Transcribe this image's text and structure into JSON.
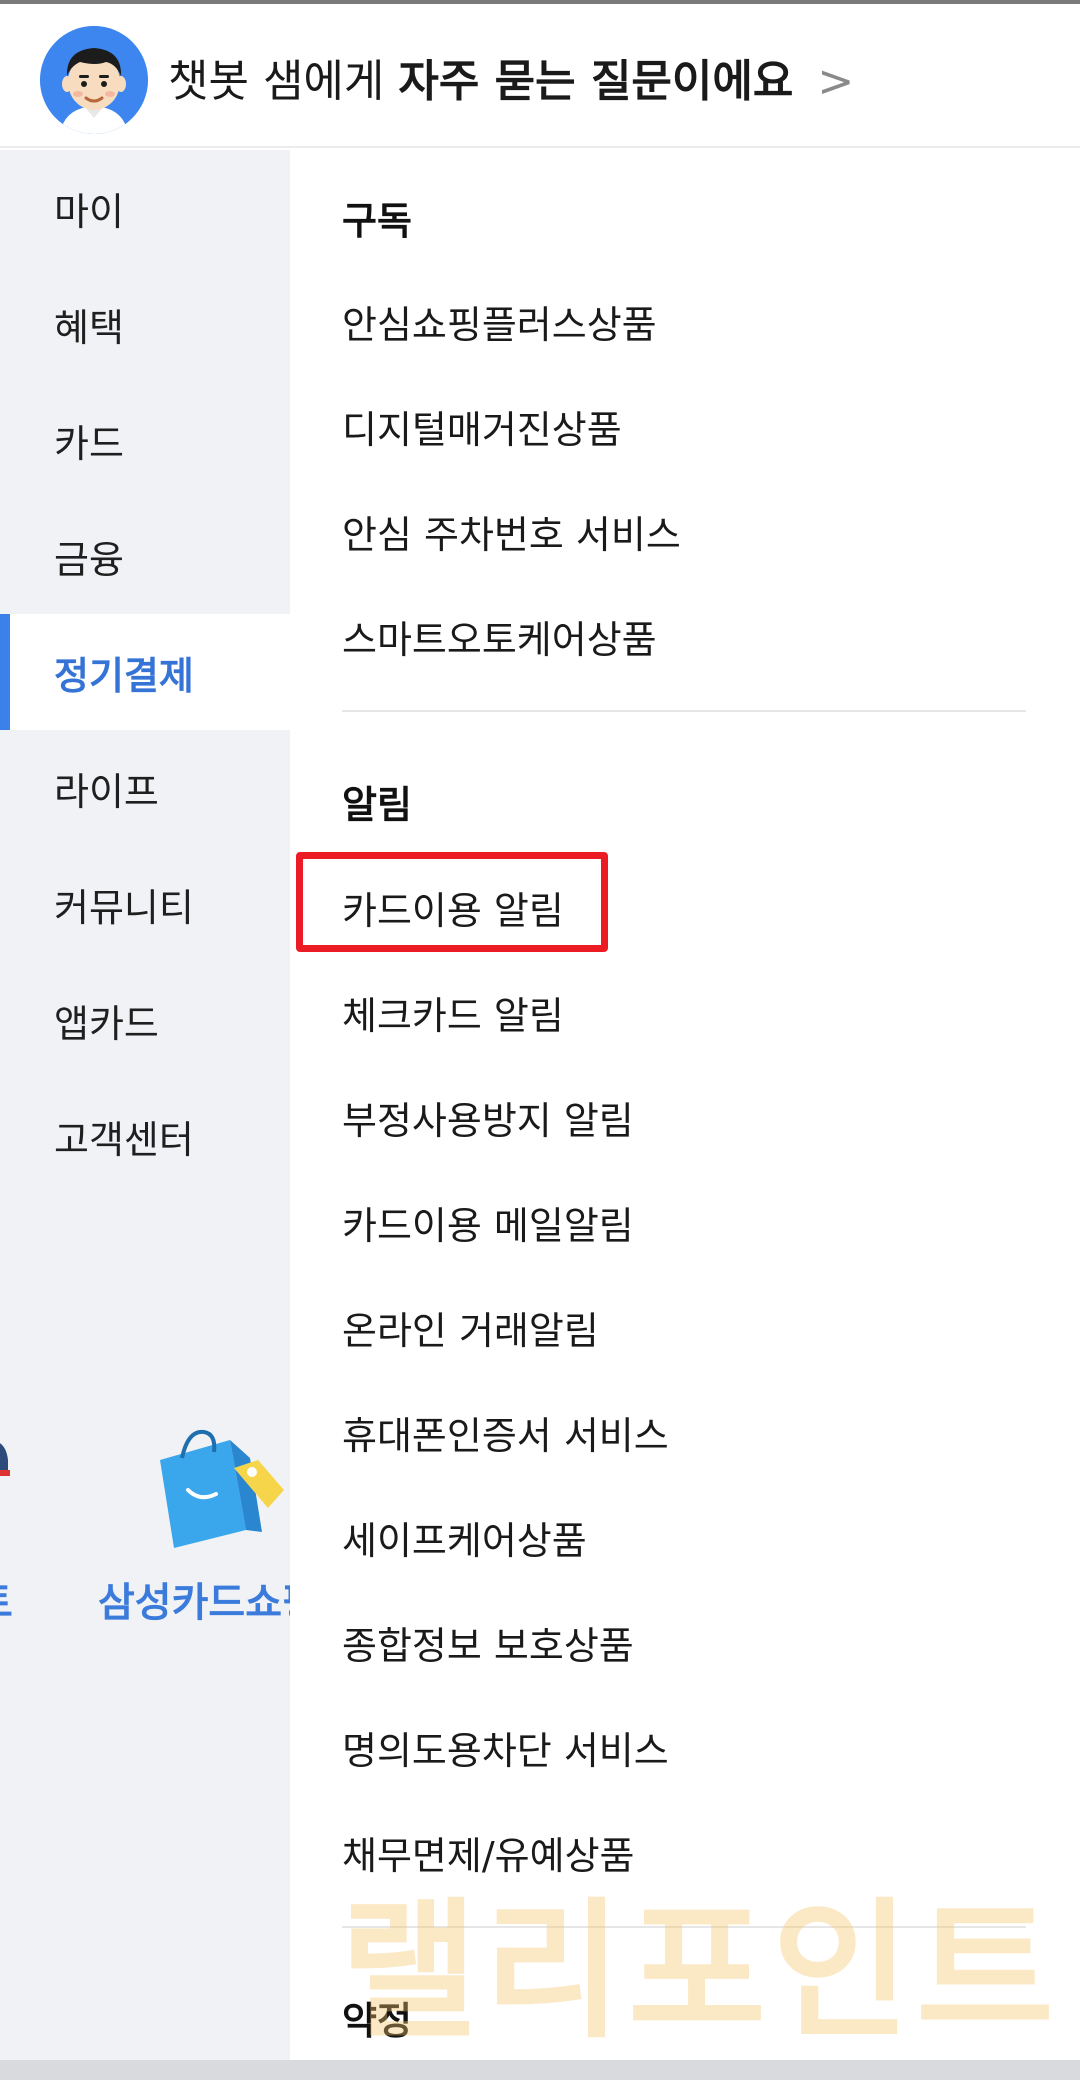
{
  "header": {
    "chatbot_prefix": "챗봇 샘에게",
    "chatbot_strong": "자주 묻는 질문이에요",
    "chevron": ">"
  },
  "sidebar": {
    "items": [
      {
        "label": "마이"
      },
      {
        "label": "혜택"
      },
      {
        "label": "카드"
      },
      {
        "label": "금융"
      },
      {
        "label": "정기결제"
      },
      {
        "label": "라이프"
      },
      {
        "label": "커뮤니티"
      },
      {
        "label": "앱카드"
      },
      {
        "label": "고객센터"
      }
    ],
    "active_index": 4,
    "promo": {
      "left_partial_label": "토",
      "shop_label": "삼성카드쇼핑"
    }
  },
  "main": {
    "sections": [
      {
        "title": "구독",
        "items": [
          "안심쇼핑플러스상품",
          "디지털매거진상품",
          "안심 주차번호 서비스",
          "스마트오토케어상품"
        ]
      },
      {
        "title": "알림",
        "items": [
          "카드이용 알림",
          "체크카드 알림",
          "부정사용방지 알림",
          "카드이용 메일알림",
          "온라인 거래알림",
          "휴대폰인증서 서비스",
          "세이프케어상품",
          "종합정보 보호상품",
          "명의도용차단 서비스",
          "채무면제/유예상품"
        ]
      },
      {
        "title": "약정",
        "items": []
      }
    ],
    "highlighted_item": "카드이용 알림"
  },
  "watermark": "랠리포인트",
  "colors": {
    "accent": "#3573d6",
    "active_bar": "#3c80ea",
    "highlight_border": "#ec1c24",
    "sidebar_bg": "#f1f2f6"
  }
}
